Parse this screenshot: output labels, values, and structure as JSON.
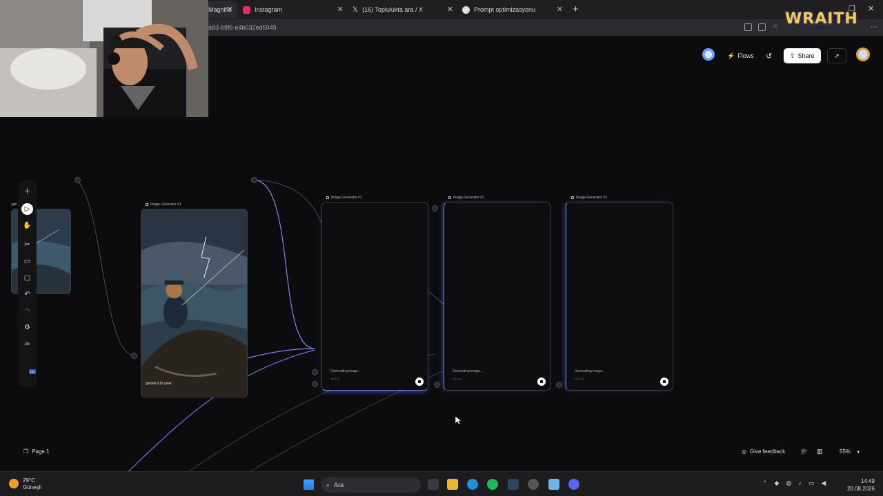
{
  "browser": {
    "tabs": [
      {
        "label": "Magnific",
        "active": true,
        "icon_color": "#cfcfcf"
      },
      {
        "label": "Instagram",
        "active": false,
        "icon_color": "#e1306c"
      },
      {
        "label": "(16) Toplulukta ara / X",
        "active": false,
        "icon_color": "#ffffff"
      },
      {
        "label": "Prompt optimizasyonu",
        "active": false,
        "icon_color": "#e0e0e0"
      }
    ],
    "new_tab": "+",
    "url": "a83-b8f6-e4b032ed5949"
  },
  "overlay": {
    "wraith_logo": "WRAITH"
  },
  "app": {
    "header": {
      "flows_label": "Flows",
      "share_label": "Share"
    },
    "nodes": [
      {
        "title": "Image Generator #1",
        "caption": "görseli 9:16 çevir"
      },
      {
        "title": "Image Generator #2",
        "status": "Generating image...",
        "time": "1m 12s"
      },
      {
        "title": "Image Generator #2",
        "status": "Generating image...",
        "time": "1m 12s"
      },
      {
        "title": "Image Generator #2",
        "status": "Generating image...",
        "time": "1m 11s"
      }
    ],
    "partial_node_title": "age",
    "toolbar_on_badge": "ON",
    "bottom": {
      "page_label": "Page 1",
      "feedback_label": "Give feedback",
      "zoom_label": "55%"
    }
  },
  "taskbar": {
    "weather_temp": "29°C",
    "weather_desc": "Güneşli",
    "search_label": "Ara",
    "time": "14:49",
    "date": "20.08.2026"
  },
  "colors": {
    "accent_blue": "#6f7ee8",
    "background": "#0c0c0e"
  }
}
